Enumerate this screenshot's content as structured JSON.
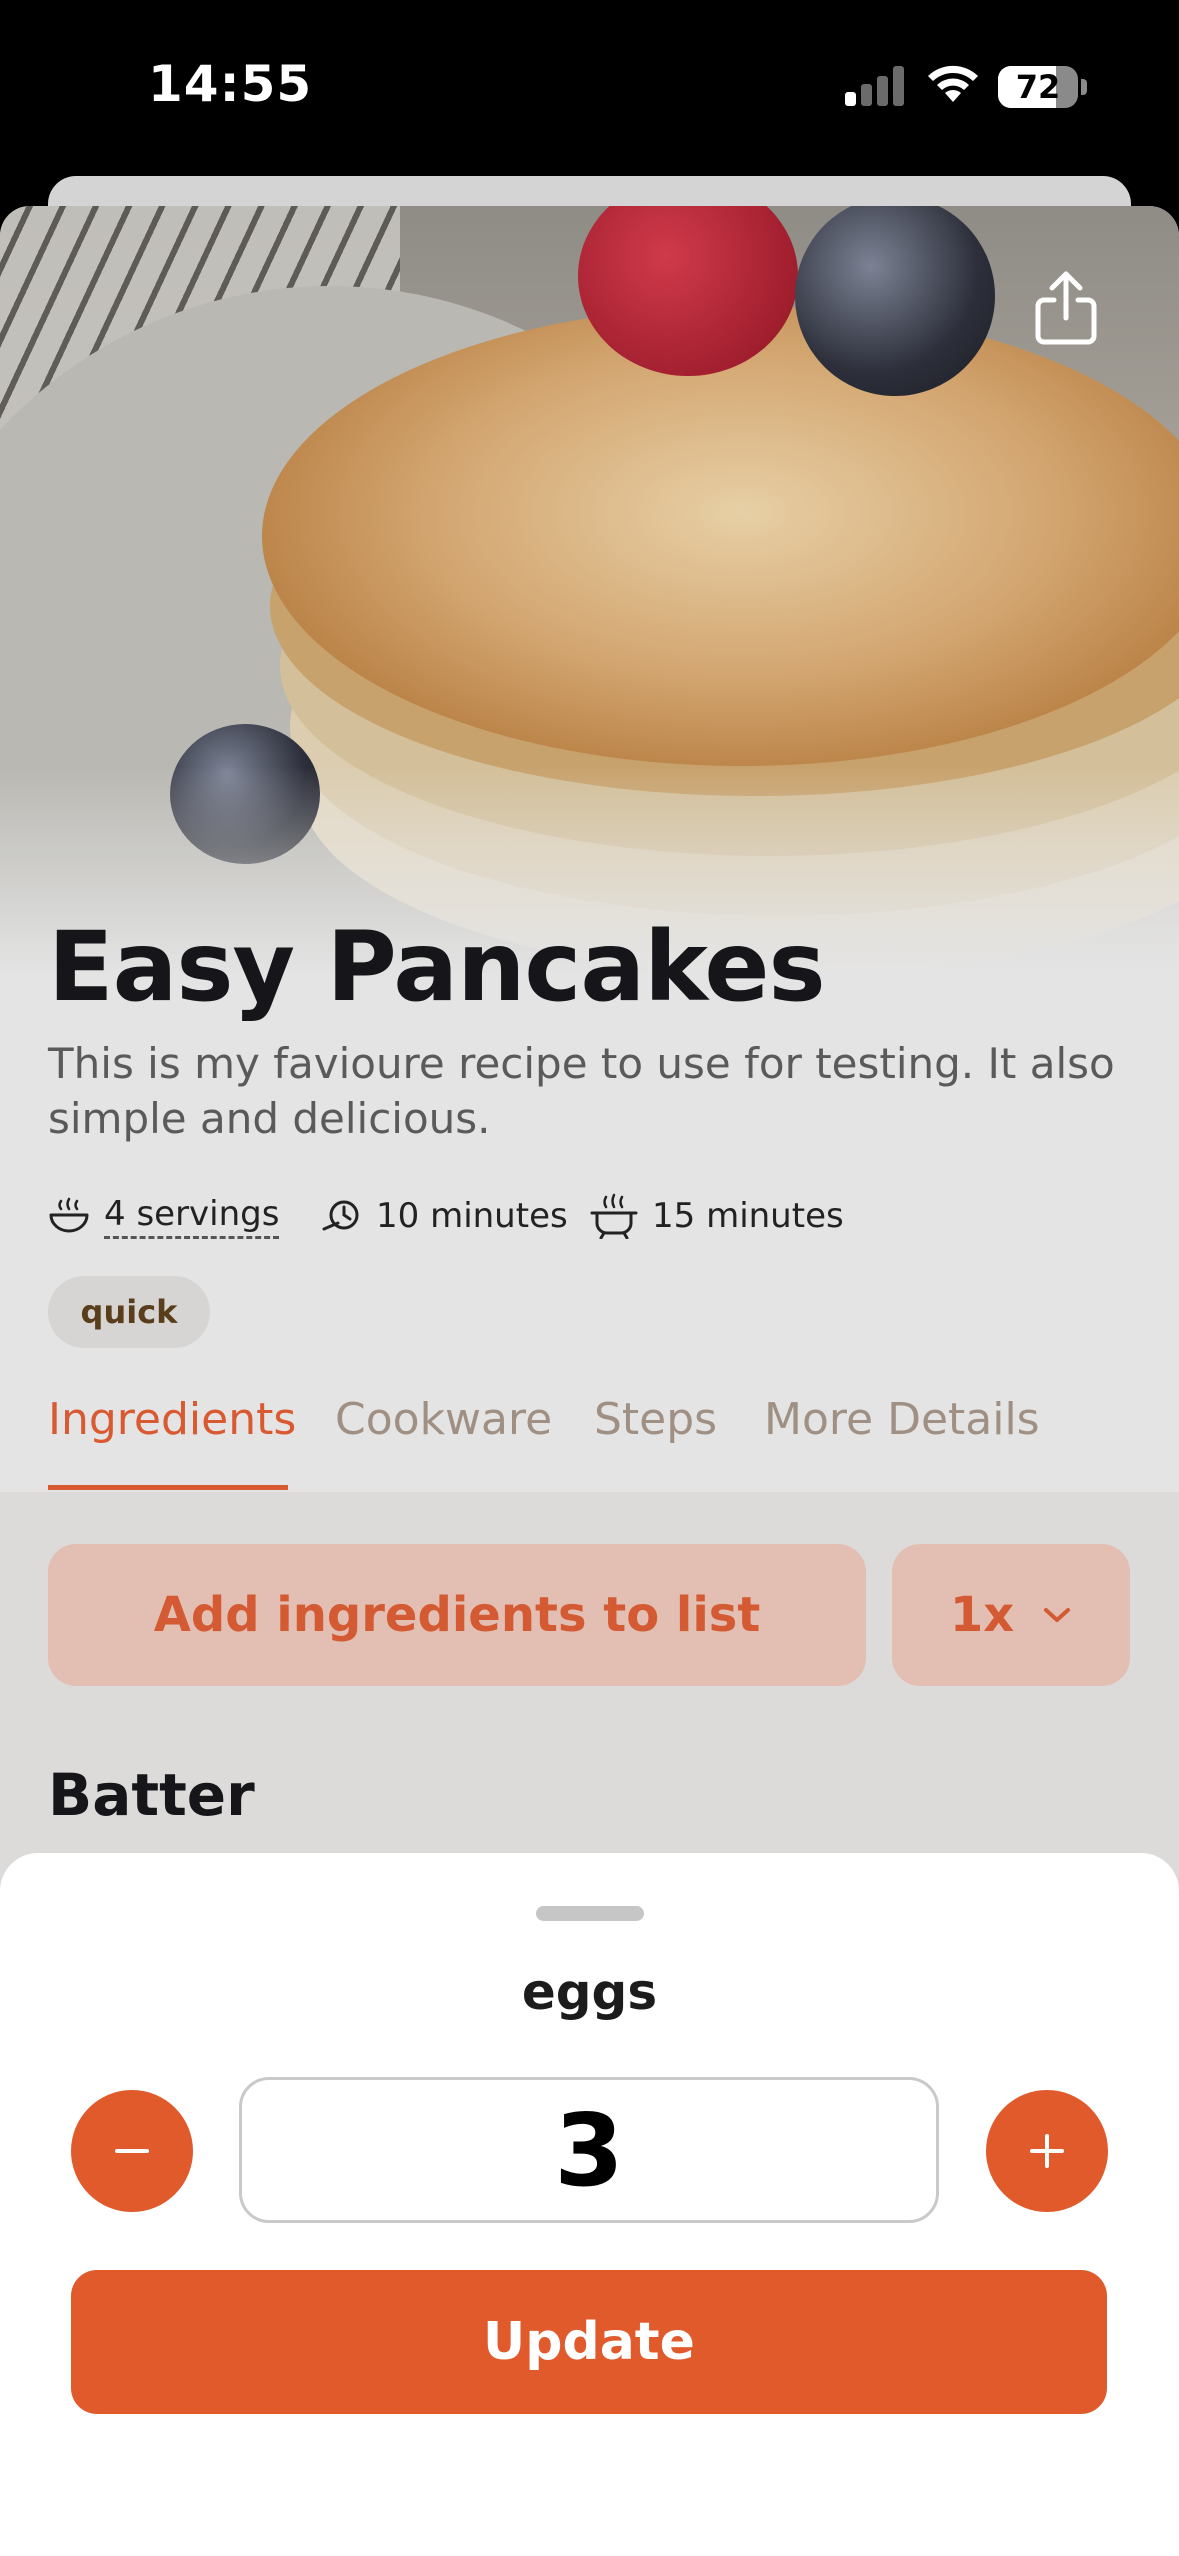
{
  "status_bar": {
    "time": "14:55",
    "battery_percent": 72
  },
  "recipe": {
    "title": "Easy Pancakes",
    "description": "This is my favioure recipe to use for testing. It also simple and delicious.",
    "servings": "4 servings",
    "prep_time": "10 minutes",
    "cook_time": "15 minutes",
    "tags": [
      "quick"
    ]
  },
  "tabs": [
    {
      "label": "Ingredients",
      "active": true
    },
    {
      "label": "Cookware",
      "active": false
    },
    {
      "label": "Steps",
      "active": false
    },
    {
      "label": "More Details",
      "active": false
    }
  ],
  "ingredients": {
    "add_button_label": "Add ingredients to list",
    "scale_label": "1x",
    "section_title": "Batter"
  },
  "edit_sheet": {
    "ingredient_name": "eggs",
    "quantity_value": "3",
    "update_label": "Update"
  },
  "icons": {
    "share": "share-icon",
    "servings": "bowl-icon",
    "prep": "prep-time-icon",
    "cook": "pot-icon",
    "scale": "chevron-down-icon",
    "minus": "minus-icon",
    "plus": "plus-icon"
  },
  "colors": {
    "accent": "#e05a2c",
    "accent_soft": "#e2bfb2",
    "tab_inactive": "#a09084",
    "title": "#15151a"
  }
}
